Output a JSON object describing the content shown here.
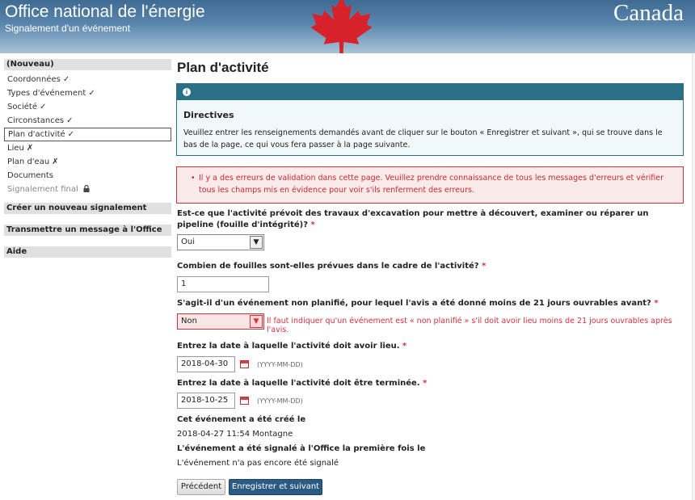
{
  "header": {
    "org_name": "Office national de l'énergie",
    "subtitle": "Signalement d'un événement",
    "wordmark": "Canada",
    "leaf_color": "#d7222c"
  },
  "nav": {
    "heading": "(Nouveau)",
    "items": [
      {
        "label": "Coordonnées",
        "mark": "✓"
      },
      {
        "label": "Types d'événement",
        "mark": "✓"
      },
      {
        "label": "Société",
        "mark": "✓"
      },
      {
        "label": "Circonstances",
        "mark": "✓"
      },
      {
        "label": "Plan d'activité",
        "mark": "✓"
      },
      {
        "label": "Lieu",
        "mark": "✗"
      },
      {
        "label": "Plan d'eau",
        "mark": "✗"
      },
      {
        "label": "Documents",
        "mark": ""
      },
      {
        "label": "Signalement final",
        "mark": "lock-icon"
      }
    ],
    "sections": [
      "Créer un nouveau signalement",
      "Transmettre un message à l'Office",
      "Aide"
    ]
  },
  "main": {
    "title": "Plan d'activité",
    "directives": {
      "heading": "Directives",
      "text": "Veuillez entrer les renseignements demandés avant de cliquer sur le bouton « Enregistrer et suivant », qui se trouve dans le bas de la page, ce qui vous fera passer à la page suivante."
    },
    "error_summary": "Il y a des erreurs de validation dans cette page. Veuillez prendre connaissance de tous les messages d'erreurs et vérifier tous les champs mis en évidence pour voir s'ils renferment des erreurs.",
    "q_excavation": {
      "label": "Est-ce que l'activité prévoit des travaux d'excavation pour mettre à découvert, examiner ou réparer un pipeline (fouille d'intégrité)?",
      "required": "*",
      "value": "Oui"
    },
    "q_fouilles": {
      "label": "Combien de fouilles sont-elles prévues dans le cadre de l'activité?",
      "required": "*",
      "value": "1"
    },
    "q_non_planifie": {
      "label": "S'agit-il d'un événement non planifié, pour lequel l'avis a été donné moins de 21 jours ouvrables avant?",
      "required": "*",
      "value": "Non",
      "error": "Il faut indiquer qu'un événement est « non planifié » s'il doit avoir lieu moins de 21 jours ouvrables après l'avis."
    },
    "q_date_debut": {
      "label": "Entrez la date à laquelle l'activité doit avoir lieu.",
      "required": "*",
      "value": "2018-04-30",
      "format": "(YYYY-MM-DD)"
    },
    "q_date_fin": {
      "label": "Entrez la date à laquelle l'activité doit être terminée.",
      "required": "*",
      "value": "2018-10-25",
      "format": "(YYYY-MM-DD)"
    },
    "created": {
      "label": "Cet événement a été créé le",
      "value": "2018-04-27 11:54 Montagne"
    },
    "reported": {
      "label": "L'événement a été signalé à l'Office la première fois le",
      "value": "L'événement n'a pas encore été signalé"
    },
    "buttons": {
      "previous": "Précédent",
      "next": "Enregistrer et suivant"
    }
  }
}
